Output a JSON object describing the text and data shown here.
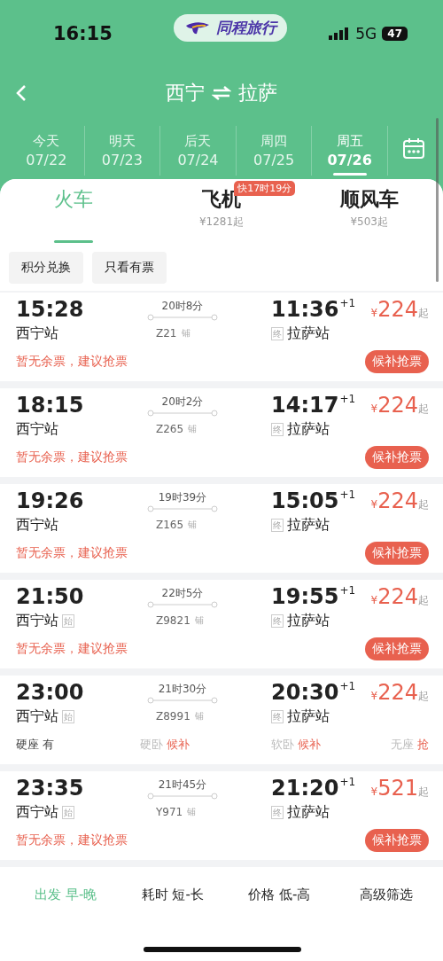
{
  "status_bar": {
    "time": "16:15",
    "app_name": "同程旅行",
    "network": "5G",
    "battery": "47"
  },
  "header": {
    "from": "西宁",
    "to": "拉萨"
  },
  "dates": [
    {
      "weekday": "今天",
      "date": "07/22",
      "selected": false
    },
    {
      "weekday": "明天",
      "date": "07/23",
      "selected": false
    },
    {
      "weekday": "后天",
      "date": "07/24",
      "selected": false
    },
    {
      "weekday": "周四",
      "date": "07/25",
      "selected": false
    },
    {
      "weekday": "周五",
      "date": "07/26",
      "selected": true
    }
  ],
  "transport_tabs": [
    {
      "label": "火车",
      "selected": true
    },
    {
      "label": "飞机",
      "price": "¥1281起",
      "badge": "快17时19分",
      "selected": false
    },
    {
      "label": "顺风车",
      "price": "¥503起",
      "selected": false
    }
  ],
  "filter_chips": [
    "积分兑换",
    "只看有票"
  ],
  "trains": [
    {
      "kind": "soldout",
      "depart": "15:28",
      "depart_station": "西宁站",
      "duration": "20时8分",
      "train_no": "Z21",
      "berth_mark": "铺",
      "terminal_badge": "终",
      "arrive": "11:36",
      "day_offset": "+1",
      "arrive_station": "拉萨站",
      "currency": "¥",
      "price": "224",
      "price_suffix": "起",
      "notice": "暂无余票，建议抢票",
      "button": "候补抢票"
    },
    {
      "kind": "soldout",
      "depart": "18:15",
      "depart_station": "西宁站",
      "duration": "20时2分",
      "train_no": "Z265",
      "berth_mark": "铺",
      "terminal_badge": "终",
      "arrive": "14:17",
      "day_offset": "+1",
      "arrive_station": "拉萨站",
      "currency": "¥",
      "price": "224",
      "price_suffix": "起",
      "notice": "暂无余票，建议抢票",
      "button": "候补抢票"
    },
    {
      "kind": "soldout",
      "depart": "19:26",
      "depart_station": "西宁站",
      "duration": "19时39分",
      "train_no": "Z165",
      "berth_mark": "铺",
      "terminal_badge": "终",
      "arrive": "15:05",
      "day_offset": "+1",
      "arrive_station": "拉萨站",
      "currency": "¥",
      "price": "224",
      "price_suffix": "起",
      "notice": "暂无余票，建议抢票",
      "button": "候补抢票"
    },
    {
      "kind": "soldout",
      "depart": "21:50",
      "depart_station": "西宁站",
      "origin_badge": "始",
      "duration": "22时5分",
      "train_no": "Z9821",
      "berth_mark": "铺",
      "terminal_badge": "终",
      "arrive": "19:55",
      "day_offset": "+1",
      "arrive_station": "拉萨站",
      "currency": "¥",
      "price": "224",
      "price_suffix": "起",
      "notice": "暂无余票，建议抢票",
      "button": "候补抢票"
    },
    {
      "kind": "seats",
      "depart": "23:00",
      "depart_station": "西宁站",
      "origin_badge": "始",
      "duration": "21时30分",
      "train_no": "Z8991",
      "berth_mark": "铺",
      "terminal_badge": "终",
      "arrive": "20:30",
      "day_offset": "+1",
      "arrive_station": "拉萨站",
      "currency": "¥",
      "price": "224",
      "price_suffix": "起",
      "seats": [
        {
          "name": "硬座",
          "status": "有",
          "available": true
        },
        {
          "name": "硬卧",
          "status": "候补",
          "available": false
        },
        {
          "name": "软卧",
          "status": "候补",
          "available": false
        },
        {
          "name": "无座",
          "status": "抢",
          "available": false
        }
      ]
    },
    {
      "kind": "soldout",
      "depart": "23:35",
      "depart_station": "西宁站",
      "origin_badge": "始",
      "duration": "21时45分",
      "train_no": "Y971",
      "berth_mark": "铺",
      "terminal_badge": "终",
      "arrive": "21:20",
      "day_offset": "+1",
      "arrive_station": "拉萨站",
      "currency": "¥",
      "price": "521",
      "price_suffix": "起",
      "notice": "暂无余票，建议抢票",
      "button": "候补抢票"
    }
  ],
  "sort_bar": [
    {
      "label": "出发 早-晚",
      "selected": true
    },
    {
      "label": "耗时 短-长",
      "selected": false
    },
    {
      "label": "价格 低-高",
      "selected": false
    },
    {
      "label": "高级筛选",
      "selected": false
    }
  ]
}
